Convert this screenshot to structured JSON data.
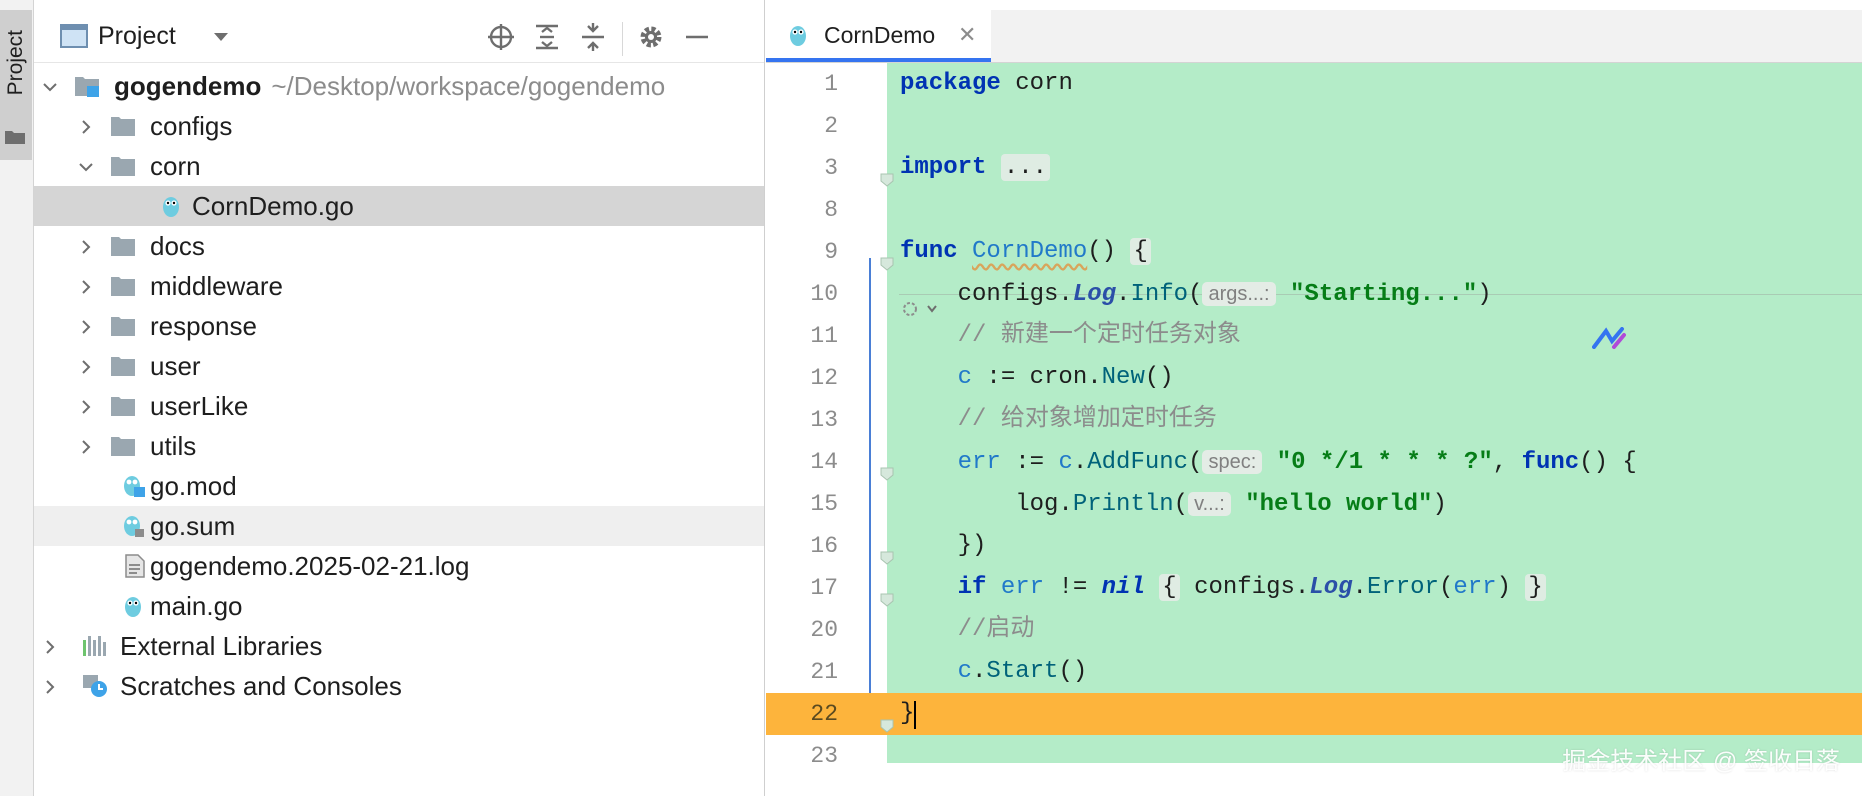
{
  "side_tab": {
    "label": "Project"
  },
  "project_panel": {
    "title": "Project",
    "header_buttons": [
      "locate-icon",
      "expand-all-icon",
      "collapse-all-icon",
      "gear-icon",
      "minimize-icon"
    ]
  },
  "tree": [
    {
      "label": "gogendemo",
      "path": "~/Desktop/workspace/gogendemo",
      "icon": "module-icon",
      "expanded": true,
      "depth": 0
    },
    {
      "label": "configs",
      "icon": "folder-icon",
      "expanded": false,
      "depth": 1
    },
    {
      "label": "corn",
      "icon": "folder-icon",
      "expanded": true,
      "depth": 1
    },
    {
      "label": "CornDemo.go",
      "icon": "go-file-icon",
      "depth": 2,
      "selected": true
    },
    {
      "label": "docs",
      "icon": "folder-icon",
      "expanded": false,
      "depth": 1
    },
    {
      "label": "middleware",
      "icon": "folder-icon",
      "expanded": false,
      "depth": 1
    },
    {
      "label": "response",
      "icon": "folder-icon",
      "expanded": false,
      "depth": 1
    },
    {
      "label": "user",
      "icon": "folder-icon",
      "expanded": false,
      "depth": 1
    },
    {
      "label": "userLike",
      "icon": "folder-icon",
      "expanded": false,
      "depth": 1
    },
    {
      "label": "utils",
      "icon": "folder-icon",
      "expanded": false,
      "depth": 1
    },
    {
      "label": "go.mod",
      "icon": "go-mod-icon",
      "depth": 1
    },
    {
      "label": "go.sum",
      "icon": "go-sum-icon",
      "depth": 1,
      "hover": true
    },
    {
      "label": "gogendemo.2025-02-21.log",
      "icon": "text-file-icon",
      "depth": 1
    },
    {
      "label": "main.go",
      "icon": "go-file-icon",
      "depth": 1
    },
    {
      "label": "External Libraries",
      "icon": "library-icon",
      "expanded": false,
      "depth": 0
    },
    {
      "label": "Scratches and Consoles",
      "icon": "scratches-icon",
      "expanded": false,
      "depth": 0
    }
  ],
  "editor": {
    "tab_label": "CornDemo",
    "close_symbol": "✕",
    "lines": [
      {
        "num": "1",
        "tokens": [
          [
            "kw",
            "package"
          ],
          [
            "",
            " corn"
          ]
        ]
      },
      {
        "num": "2",
        "tokens": []
      },
      {
        "num": "3",
        "tokens": [
          [
            "kw",
            "import"
          ],
          [
            "",
            " "
          ],
          [
            "fold",
            "..."
          ]
        ]
      },
      {
        "num": "8",
        "tokens": []
      },
      {
        "num": "9",
        "tokens": [
          [
            "kw",
            "func"
          ],
          [
            "",
            " "
          ],
          [
            "fnu",
            "CornDemo"
          ],
          [
            "",
            "() "
          ],
          [
            "fold",
            "{"
          ]
        ]
      },
      {
        "num": "10",
        "tokens": [
          [
            "",
            "    configs."
          ],
          [
            "gl",
            "Log"
          ],
          [
            "",
            "."
          ],
          [
            "fn",
            "Info"
          ],
          [
            "",
            "("
          ],
          [
            "hint",
            "args...:"
          ],
          [
            "",
            " "
          ],
          [
            "str",
            "\"Starting...\""
          ],
          [
            "",
            ")"
          ]
        ]
      },
      {
        "num": "11",
        "tokens": [
          [
            "cm",
            "    // 新建一个定时任务对象"
          ]
        ]
      },
      {
        "num": "12",
        "tokens": [
          [
            "vr",
            "    c"
          ],
          [
            "",
            " := cron."
          ],
          [
            "fn",
            "New"
          ],
          [
            "",
            "()"
          ]
        ]
      },
      {
        "num": "13",
        "tokens": [
          [
            "cm",
            "    // 给对象增加定时任务"
          ]
        ]
      },
      {
        "num": "14",
        "tokens": [
          [
            "vr",
            "    err"
          ],
          [
            "",
            " := "
          ],
          [
            "vr",
            "c"
          ],
          [
            "",
            "."
          ],
          [
            "fn",
            "AddFunc"
          ],
          [
            "",
            "("
          ],
          [
            "hint",
            "spec:"
          ],
          [
            "",
            " "
          ],
          [
            "str",
            "\"0 */1 * * * ?\""
          ],
          [
            "",
            ", "
          ],
          [
            "kw",
            "func"
          ],
          [
            "",
            "() {"
          ]
        ]
      },
      {
        "num": "15",
        "tokens": [
          [
            "",
            "        log."
          ],
          [
            "fn",
            "Println"
          ],
          [
            "",
            "("
          ],
          [
            "hint",
            "v...:"
          ],
          [
            "",
            " "
          ],
          [
            "str",
            "\"hello world\""
          ],
          [
            "",
            ")"
          ]
        ]
      },
      {
        "num": "16",
        "tokens": [
          [
            "",
            "    })"
          ]
        ]
      },
      {
        "num": "17",
        "tokens": [
          [
            "kw",
            "    if"
          ],
          [
            "",
            " "
          ],
          [
            "vr",
            "err"
          ],
          [
            "",
            " != "
          ],
          [
            "kwi",
            "nil"
          ],
          [
            "",
            " "
          ],
          [
            "fold",
            "{"
          ],
          [
            "",
            " configs."
          ],
          [
            "gl",
            "Log"
          ],
          [
            "",
            "."
          ],
          [
            "fn",
            "Error"
          ],
          [
            "",
            "("
          ],
          [
            "vr",
            "err"
          ],
          [
            "",
            ") "
          ],
          [
            "fold",
            "}"
          ]
        ]
      },
      {
        "num": "20",
        "tokens": [
          [
            "cm",
            "    //启动"
          ]
        ]
      },
      {
        "num": "21",
        "tokens": [
          [
            "vr",
            "    c"
          ],
          [
            "",
            "."
          ],
          [
            "fn",
            "Start"
          ],
          [
            "",
            "()"
          ]
        ]
      },
      {
        "num": "22",
        "tokens": [
          [
            "",
            "}"
          ]
        ],
        "current": true
      },
      {
        "num": "23",
        "tokens": []
      }
    ]
  },
  "watermark": "掘金技术社区 @ 签收日落"
}
